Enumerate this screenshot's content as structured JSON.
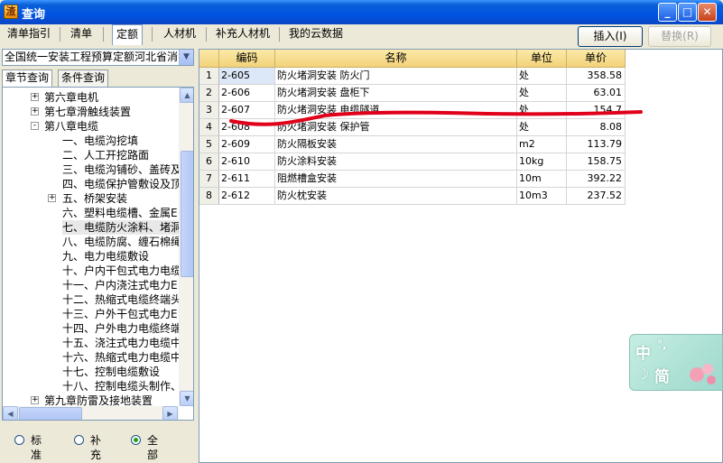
{
  "window": {
    "title": "查询",
    "app_icon_char": "渣"
  },
  "toptabs": [
    {
      "label": "清单指引"
    },
    {
      "label": "清单"
    },
    {
      "label": "定额",
      "active": true
    },
    {
      "label": "人材机"
    },
    {
      "label": "补充人材机"
    },
    {
      "label": "我的云数据"
    }
  ],
  "buttons": {
    "insert": "插入(I)",
    "replace": "替换(R)"
  },
  "left": {
    "quota_library": "全国统一安装工程预算定额河北省消",
    "subtabs": [
      {
        "label": "章节查询",
        "active": true
      },
      {
        "label": "条件查询"
      }
    ],
    "tree": [
      {
        "label": "第六章电机",
        "level": 0,
        "expander": "+"
      },
      {
        "label": "第七章滑触线装置",
        "level": 0,
        "expander": "+"
      },
      {
        "label": "第八章电缆",
        "level": 0,
        "expander": "-"
      },
      {
        "label": "一、电缆沟挖填",
        "level": 1
      },
      {
        "label": "二、人工开挖路面",
        "level": 1
      },
      {
        "label": "三、电缆沟铺砂、盖砖及",
        "level": 1
      },
      {
        "label": "四、电缆保护管敷设及顶",
        "level": 1
      },
      {
        "label": "五、桥架安装",
        "level": 1,
        "expander": "+"
      },
      {
        "label": "六、塑料电缆槽、金属E",
        "level": 1
      },
      {
        "label": "七、电缆防火涂料、堵洞",
        "level": 1,
        "selected": true
      },
      {
        "label": "八、电缆防腐、缠石棉绳",
        "level": 1
      },
      {
        "label": "九、电力电缆敷设",
        "level": 1
      },
      {
        "label": "十、户内干包式电力电缆",
        "level": 1
      },
      {
        "label": "十一、户内浇注式电力E",
        "level": 1
      },
      {
        "label": "十二、热缩式电缆终端头",
        "level": 1
      },
      {
        "label": "十三、户外干包式电力E",
        "level": 1
      },
      {
        "label": "十四、户外电力电缆终端",
        "level": 1
      },
      {
        "label": "十五、浇注式电力电缆中",
        "level": 1
      },
      {
        "label": "十六、热缩式电力电缆中",
        "level": 1
      },
      {
        "label": "十七、控制电缆敷设",
        "level": 1
      },
      {
        "label": "十八、控制电缆头制作、",
        "level": 1
      },
      {
        "label": "第九章防雷及接地装置",
        "level": 0,
        "expander": "+"
      }
    ],
    "radios": [
      {
        "label": "标准",
        "checked": false
      },
      {
        "label": "补充",
        "checked": false
      },
      {
        "label": "全部",
        "checked": true
      }
    ]
  },
  "grid": {
    "headers": {
      "rn": "",
      "code": "编码",
      "name": "名称",
      "unit": "单位",
      "price": "单价"
    },
    "rows": [
      {
        "rn": "1",
        "code": "2-605",
        "name": "防火堵洞安装 防火门",
        "unit": "处",
        "price": "358.58"
      },
      {
        "rn": "2",
        "code": "2-606",
        "name": "防火堵洞安装 盘柜下",
        "unit": "处",
        "price": "63.01"
      },
      {
        "rn": "3",
        "code": "2-607",
        "name": "防火堵洞安装 电缆隧道",
        "unit": "处",
        "price": "154.7"
      },
      {
        "rn": "4",
        "code": "2-608",
        "name": "防火堵洞安装 保护管",
        "unit": "处",
        "price": "8.08"
      },
      {
        "rn": "5",
        "code": "2-609",
        "name": "防火隔板安装",
        "unit": "m2",
        "price": "113.79"
      },
      {
        "rn": "6",
        "code": "2-610",
        "name": "防火涂料安装",
        "unit": "10kg",
        "price": "158.75"
      },
      {
        "rn": "7",
        "code": "2-611",
        "name": "阻燃槽盒安装",
        "unit": "10m",
        "price": "392.22"
      },
      {
        "rn": "8",
        "code": "2-612",
        "name": "防火枕安装",
        "unit": "10m3",
        "price": "237.52"
      }
    ]
  },
  "ime": {
    "lang": "中",
    "punct": "°,",
    "mode_icon": "moon-icon",
    "mode": "简"
  },
  "colors": {
    "annotation_red": "#e0001a",
    "title_blue": "#0054e3",
    "header_yellow": "#f3d27a"
  }
}
